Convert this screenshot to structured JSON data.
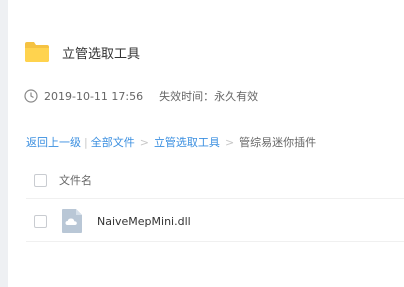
{
  "folder": {
    "title": "立管选取工具",
    "icon": "folder-icon",
    "icon_color": "#f5c242"
  },
  "meta": {
    "date": "2019-10-11 17:56",
    "expiry": "失效时间：永久有效"
  },
  "breadcrumb": {
    "back": "返回上一级",
    "separator": "|",
    "all_files": "全部文件",
    "arrow": ">",
    "folder": "立管选取工具",
    "current": "管综易迷你插件"
  },
  "table": {
    "column_filename": "文件名",
    "rows": [
      {
        "name": "NaiveMepMini.dll",
        "icon": "file-cloud-icon"
      }
    ]
  },
  "colors": {
    "link": "#3b8fe0",
    "background": "#eef0f3"
  }
}
